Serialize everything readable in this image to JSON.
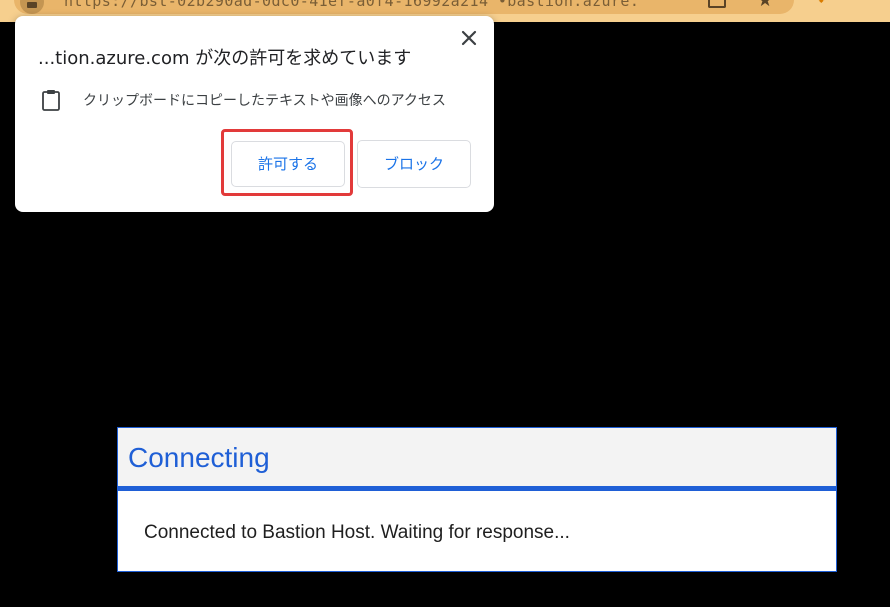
{
  "browser": {
    "url": "https://bst-02b290ad-0dc0-41ef-a0f4-16992a214 •bastion.azure.",
    "accent_color": "#f6cf8e",
    "icons": [
      "site-info-icon",
      "tab-search-icon",
      "bookmark-star-icon",
      "extension-icon"
    ]
  },
  "permission_popup": {
    "title": "...tion.azure.com が次の許可を求めています",
    "permission_text": "クリップボードにコピーしたテキストや画像へのアクセス",
    "allow_label": "許可する",
    "block_label": "ブロック",
    "button_text_color": "#1a73e8",
    "highlight_color": "#e23a3a"
  },
  "connect_dialog": {
    "title": "Connecting",
    "message": "Connected to Bastion Host. Waiting for response...",
    "accent_color": "#1f5fd6"
  }
}
